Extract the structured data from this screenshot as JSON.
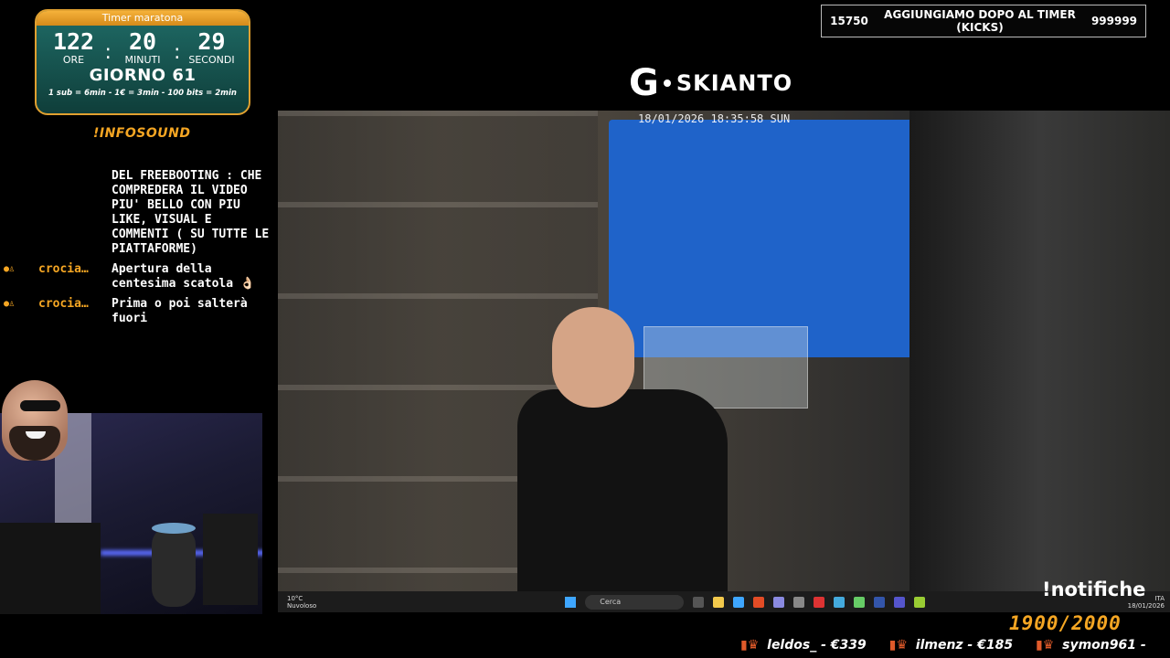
{
  "timer": {
    "title": "Timer maratona",
    "hours": "122",
    "minutes": "20",
    "seconds": "29",
    "hours_label": "ORE",
    "minutes_label": "MINUTI",
    "seconds_label": "SECONDI",
    "day": "GIORNO 61",
    "rates": "1 sub = 6min - 1€ = 3min - 100 bits = 2min"
  },
  "infosound": "!INFOSOUND",
  "chat": {
    "messages": [
      {
        "user": "",
        "text": "DEL FREEBOOTING : CHE COMPREDERA IL VIDEO PIU' BELLO CON PIU LIKE, VISUAL E COMMENTI ( SU TUTTE LE PIATTAFORME)"
      },
      {
        "user": "crocia…",
        "text": "Apertura della centesima scatola 👌🏻"
      },
      {
        "user": "crocia…",
        "text": "Prima o poi salterà fuori"
      }
    ]
  },
  "goal": {
    "current": "15750",
    "label": "AGGIUNGIAMO DOPO AL TIMER (KICKS)",
    "target": "999999"
  },
  "brand": {
    "letter": "G",
    "name": "SKIANTO"
  },
  "camera": {
    "timestamp": "18/01/2026 18:35:58 SUN"
  },
  "taskbar": {
    "temp": "10°C",
    "weather": "Nuvoloso",
    "search_placeholder": "Cerca",
    "lang": "ITA",
    "date": "18/01/2026",
    "app_colors": [
      "#f2c94c",
      "#3ea6ff",
      "#e34c26",
      "#888",
      "#5a7",
      "#d33",
      "#4ad",
      "#6c6",
      "#2a2",
      "#35a",
      "#55c",
      "#9c3"
    ]
  },
  "notifiche": "!notifiche",
  "counter": "1900/2000",
  "ticker": [
    {
      "user": "leldos_",
      "amount": "€339"
    },
    {
      "user": "ilmenz",
      "amount": "€185"
    },
    {
      "user": "symon961",
      "amount": ""
    }
  ]
}
